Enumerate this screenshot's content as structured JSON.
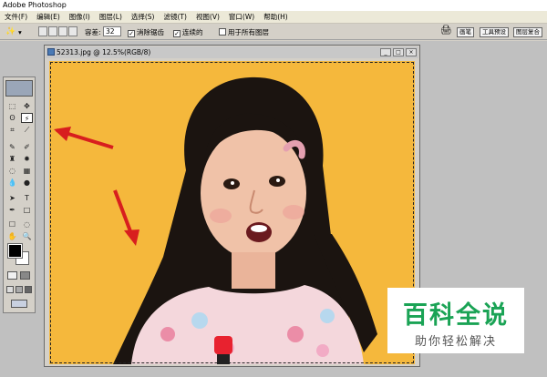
{
  "app": {
    "title": "Adobe Photoshop"
  },
  "menu": [
    "文件(F)",
    "编辑(E)",
    "图像(I)",
    "图层(L)",
    "选择(S)",
    "滤镜(T)",
    "视图(V)",
    "窗口(W)",
    "帮助(H)"
  ],
  "options": {
    "tolerance_label": "容差:",
    "tolerance_value": "32",
    "antialias_label": "消除锯齿",
    "contiguous_label": "连续的",
    "all_layers_label": "用于所有图层"
  },
  "palette_tabs": [
    "画笔",
    "工具预设",
    "图层复合"
  ],
  "toolbox": {
    "tools": [
      "⬚",
      "✥",
      "ʘ",
      "⚡",
      "⌗",
      "⟋",
      "✎",
      "✐",
      "♜",
      "✹",
      "◌",
      "▦",
      "💧",
      "●",
      "➤",
      "T",
      "✒",
      "□",
      "☐",
      "◌",
      "✋",
      "🔍"
    ]
  },
  "document": {
    "title": "52313.jpg @ 12.5%(RGB/8)",
    "bg_color": "#f5b83c"
  },
  "watermark": {
    "title": "百科全说",
    "subtitle": "助你轻松解决"
  }
}
